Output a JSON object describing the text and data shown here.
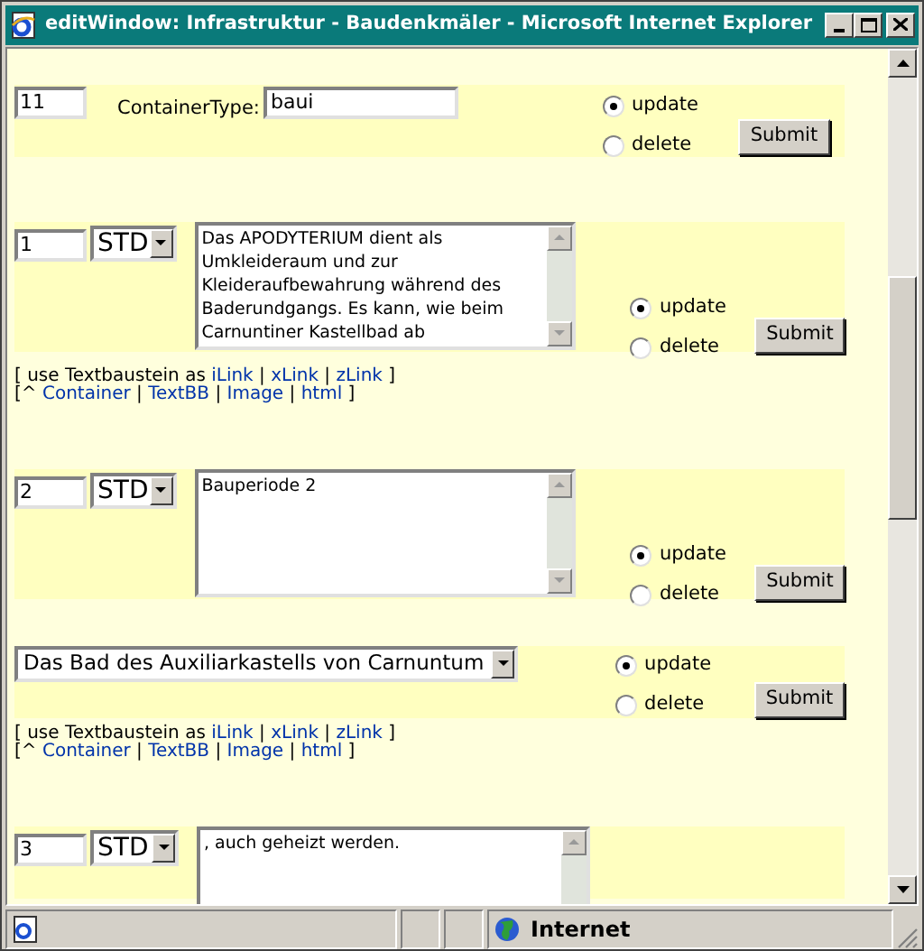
{
  "window": {
    "title": "editWindow: Infrastruktur - Baudenkmäler - Microsoft Internet Explorer"
  },
  "blocks": [
    {
      "kind": "container",
      "number": "11",
      "type_label": "ContainerType:",
      "type_value": "baui",
      "options": [
        {
          "label": "update",
          "selected": true
        },
        {
          "label": "delete",
          "selected": false
        }
      ],
      "submit": "Submit"
    },
    {
      "kind": "text",
      "number": "1",
      "style": "STD",
      "text": "Das APODYTERIUM dient als Umkleideraum und zur Kleideraufbewahrung während des Baderundgangs. Es kann, wie beim Carnuntiner Kastellbad ab",
      "options": [
        {
          "label": "update",
          "selected": true
        },
        {
          "label": "delete",
          "selected": false
        }
      ],
      "submit": "Submit"
    },
    {
      "kind": "links",
      "lines": [
        [
          {
            "text": "[ use Textbaustein as ",
            "kind": "plain"
          },
          {
            "text": "iLink",
            "kind": "link"
          },
          {
            "text": " | ",
            "kind": "plain"
          },
          {
            "text": "xLink",
            "kind": "link"
          },
          {
            "text": " | ",
            "kind": "plain"
          },
          {
            "text": "zLink",
            "kind": "link"
          },
          {
            "text": " ]",
            "kind": "plain"
          }
        ],
        [
          {
            "text": "[^ ",
            "kind": "plain"
          },
          {
            "text": "Container",
            "kind": "link"
          },
          {
            "text": " | ",
            "kind": "plain"
          },
          {
            "text": "TextBB",
            "kind": "link"
          },
          {
            "text": " | ",
            "kind": "plain"
          },
          {
            "text": "Image",
            "kind": "link"
          },
          {
            "text": " | ",
            "kind": "plain"
          },
          {
            "text": "html",
            "kind": "link"
          },
          {
            "text": " ]",
            "kind": "plain"
          }
        ]
      ]
    },
    {
      "kind": "text",
      "number": "2",
      "style": "STD",
      "text": "Bauperiode 2",
      "options": [
        {
          "label": "update",
          "selected": true
        },
        {
          "label": "delete",
          "selected": false
        }
      ],
      "submit": "Submit"
    },
    {
      "kind": "heading",
      "value": "Das Bad des Auxiliarkastells von Carnuntum",
      "options": [
        {
          "label": "update",
          "selected": true
        },
        {
          "label": "delete",
          "selected": false
        }
      ],
      "submit": "Submit"
    },
    {
      "kind": "links",
      "lines": [
        [
          {
            "text": "[ use Textbaustein as ",
            "kind": "plain"
          },
          {
            "text": "iLink",
            "kind": "link"
          },
          {
            "text": " | ",
            "kind": "plain"
          },
          {
            "text": "xLink",
            "kind": "link"
          },
          {
            "text": " | ",
            "kind": "plain"
          },
          {
            "text": "zLink",
            "kind": "link"
          },
          {
            "text": " ]",
            "kind": "plain"
          }
        ],
        [
          {
            "text": "[^ ",
            "kind": "plain"
          },
          {
            "text": "Container",
            "kind": "link"
          },
          {
            "text": " | ",
            "kind": "plain"
          },
          {
            "text": "TextBB",
            "kind": "link"
          },
          {
            "text": " | ",
            "kind": "plain"
          },
          {
            "text": "Image",
            "kind": "link"
          },
          {
            "text": " | ",
            "kind": "plain"
          },
          {
            "text": "html",
            "kind": "link"
          },
          {
            "text": " ]",
            "kind": "plain"
          }
        ]
      ]
    },
    {
      "kind": "partial",
      "number": "3",
      "style": "STD",
      "text": ", auch geheizt werden."
    }
  ],
  "status_bar": {
    "zone": "Internet"
  }
}
